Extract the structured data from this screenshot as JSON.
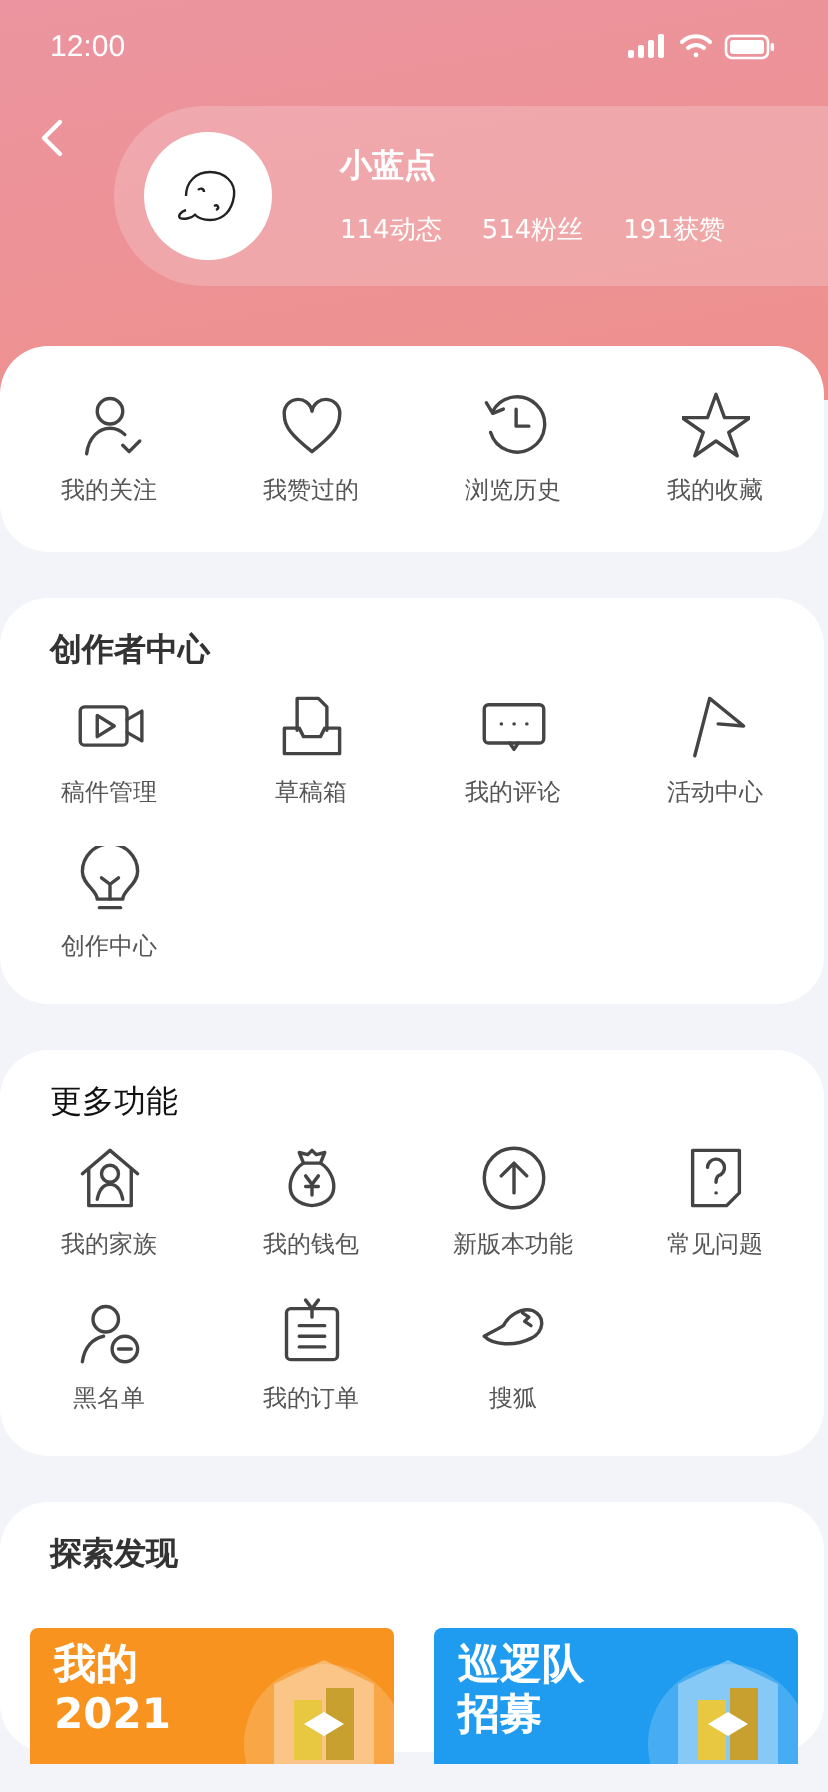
{
  "status_bar": {
    "time": "12:00"
  },
  "profile": {
    "name": "小蓝点",
    "stats": [
      "114动态",
      "514粉丝",
      "191获赞"
    ]
  },
  "quick_links": [
    {
      "label": "我的关注"
    },
    {
      "label": "我赞过的"
    },
    {
      "label": "浏览历史"
    },
    {
      "label": "我的收藏"
    }
  ],
  "sections": [
    {
      "title": "创作者中心",
      "bold": true,
      "items": [
        {
          "label": "稿件管理"
        },
        {
          "label": "草稿箱"
        },
        {
          "label": "我的评论"
        },
        {
          "label": "活动中心"
        },
        {
          "label": "创作中心"
        }
      ]
    },
    {
      "title": "更多功能",
      "bold": false,
      "items": [
        {
          "label": "我的家族"
        },
        {
          "label": "我的钱包"
        },
        {
          "label": "新版本功能"
        },
        {
          "label": "常见问题"
        },
        {
          "label": "黑名单"
        },
        {
          "label": "我的订单"
        },
        {
          "label": "搜狐"
        }
      ]
    }
  ],
  "discover": {
    "title": "探索发现",
    "banners": [
      {
        "lines": [
          "我的",
          "2021"
        ],
        "color": "#f7931e"
      },
      {
        "lines": [
          "巡逻队",
          "招募"
        ],
        "color": "#1f9cf0"
      }
    ]
  }
}
